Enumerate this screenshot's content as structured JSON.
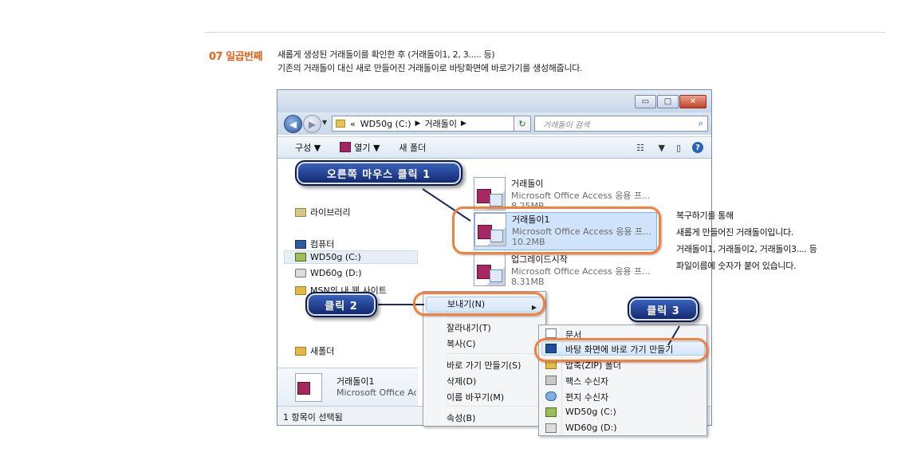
{
  "step": {
    "number_title": "07 일곱번째",
    "desc_line1": "새롭게 생성된 거래돌이를 확인한 후 (거래돌이1, 2, 3..... 등)",
    "desc_line2": "기존의 거래돌이 대신 새로 만들어진 거래돌이로 바탕화면에 바로가기를 생성해줍니다."
  },
  "window": {
    "title_buttons": {
      "minimize": "▭",
      "maximize": "□",
      "close": "✕"
    },
    "address": {
      "prefix": "«",
      "drive": "WD50g (C:)",
      "folder": "거래돌이"
    },
    "search_placeholder": "거래돌이 검색",
    "toolbar": {
      "organize": "구성 ▼",
      "open": "열기 ▼",
      "new_folder": "새 폴더",
      "view": "▼"
    },
    "nav": {
      "libraries": "라이브러리",
      "computer": "컴퓨터",
      "drive_c": "WD50g (C:)",
      "drive_d": "WD60g (D:)",
      "msn": "MSN의 내 웹 사이트",
      "new_folder": "새폴더"
    },
    "files": [
      {
        "name": "거래돌이",
        "type": "Microsoft Office Access 응용 프...",
        "size": "8.25MB"
      },
      {
        "name": "거래돌이1",
        "type": "Microsoft Office Access 응용 프...",
        "size": "10.2MB"
      },
      {
        "name": "업그레이드시작",
        "type": "Microsoft Office Access 응용 프...",
        "size": "8.31MB"
      }
    ],
    "details": {
      "name": "거래돌이1",
      "type": "Microsoft Office Access"
    },
    "status": "1 항목이 선택됨"
  },
  "context_menu": {
    "send_to": "보내기(N)",
    "cut": "잘라내기(T)",
    "copy": "복사(C)",
    "create_shortcut": "바로 가기 만들기(S)",
    "delete": "삭제(D)",
    "rename": "이름 바꾸기(M)",
    "properties": "속성(B)"
  },
  "submenu": {
    "documents": "문서",
    "desktop_shortcut": "바탕 화면에 바로 가기 만들기",
    "zip": "압축(ZIP) 폴더",
    "fax": "팩스 수신자",
    "mail": "편지 수신자",
    "drive_c": "WD50g (C:)",
    "drive_d": "WD60g (D:)"
  },
  "callouts": {
    "right_click": "오른쪽 마우스 클릭 1",
    "click2": "클릭 2",
    "click3": "클릭 3"
  },
  "note": {
    "line1": "복구하기를 통해",
    "line2": "새롭게 만들어진 거래돌이입니다.",
    "line3": "거래돌이1, 거래돌이2, 거래돌이3.... 등",
    "line4": "파일이름에 숫자가 붙어 있습니다."
  },
  "colors": {
    "accent_orange": "#f2813e",
    "step_title": "#e8611a",
    "callout_blue": "#1f3f93"
  }
}
